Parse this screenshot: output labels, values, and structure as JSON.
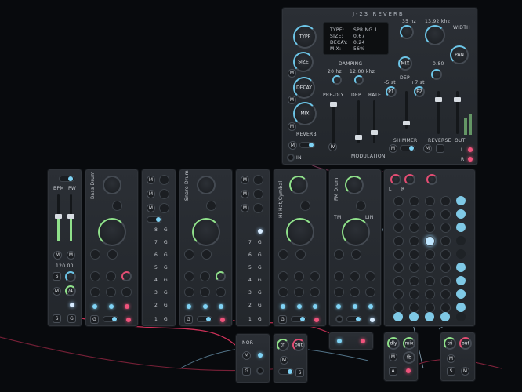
{
  "reverb": {
    "title": "J-23 REVERB",
    "screen": {
      "type_key": "TYPE:",
      "type_val": "SPRING 1",
      "size_key": "SIZE:",
      "size_val": "0.67",
      "decay_key": "DECAY:",
      "decay_val": "0.24",
      "mix_key": "MIX:",
      "mix_val": "56%"
    },
    "knob_type": "TYPE",
    "knob_size": "SIZE",
    "knob_decay": "DECAY",
    "knob_mix": "MIX",
    "damping_label": "DAMPING",
    "damping_low": "20 hz",
    "damping_high": "12.00 khz",
    "hp_value": "35 hz",
    "lp_value": "13.92 khz",
    "width_label": "WIDTH",
    "pan_label": "PAN",
    "mix_small": "MIX",
    "dep_label": "DEP",
    "shift_down": "-5 st",
    "shift_up": "+7 st",
    "p1": "P1",
    "p2": "P2",
    "val_080": "0.80",
    "predly": "PRE-DLY",
    "dep": "DEP",
    "rate": "RATE",
    "reverb_label": "REVERB",
    "modulation": "MODULATION",
    "shimmer": "SHIMMER",
    "reverse": "REVERSE",
    "out": "OUT",
    "in": "IN",
    "l": "L",
    "r": "R",
    "m": "M",
    "iv": "IV"
  },
  "clock": {
    "bpm": "BPM",
    "pw": "PW",
    "tempo": "120.00",
    "s": "S",
    "g": "G",
    "m": "M",
    "div": "/4"
  },
  "modules": {
    "bass_drum": "Bass Drum",
    "snare_drum": "Snare Drum",
    "hihat": "Hi Hat/Cymbal",
    "fm_drum": "FM Drum",
    "tm": "TM",
    "lin": "LIN"
  },
  "sequencer_steps": [
    "8",
    "7",
    "6",
    "5",
    "4",
    "3",
    "2",
    "1"
  ],
  "seq_g": "G",
  "bottom": {
    "nor": "NOR",
    "tri": "tri",
    "out": "out",
    "dly": "dly",
    "mix": "mix",
    "fb": "fb",
    "g": "G",
    "s": "S",
    "m": "M",
    "a": "A"
  },
  "colors": {
    "accent_blue": "#7fd3f5",
    "accent_green": "#8fe08a",
    "accent_pink": "#f0537c"
  }
}
